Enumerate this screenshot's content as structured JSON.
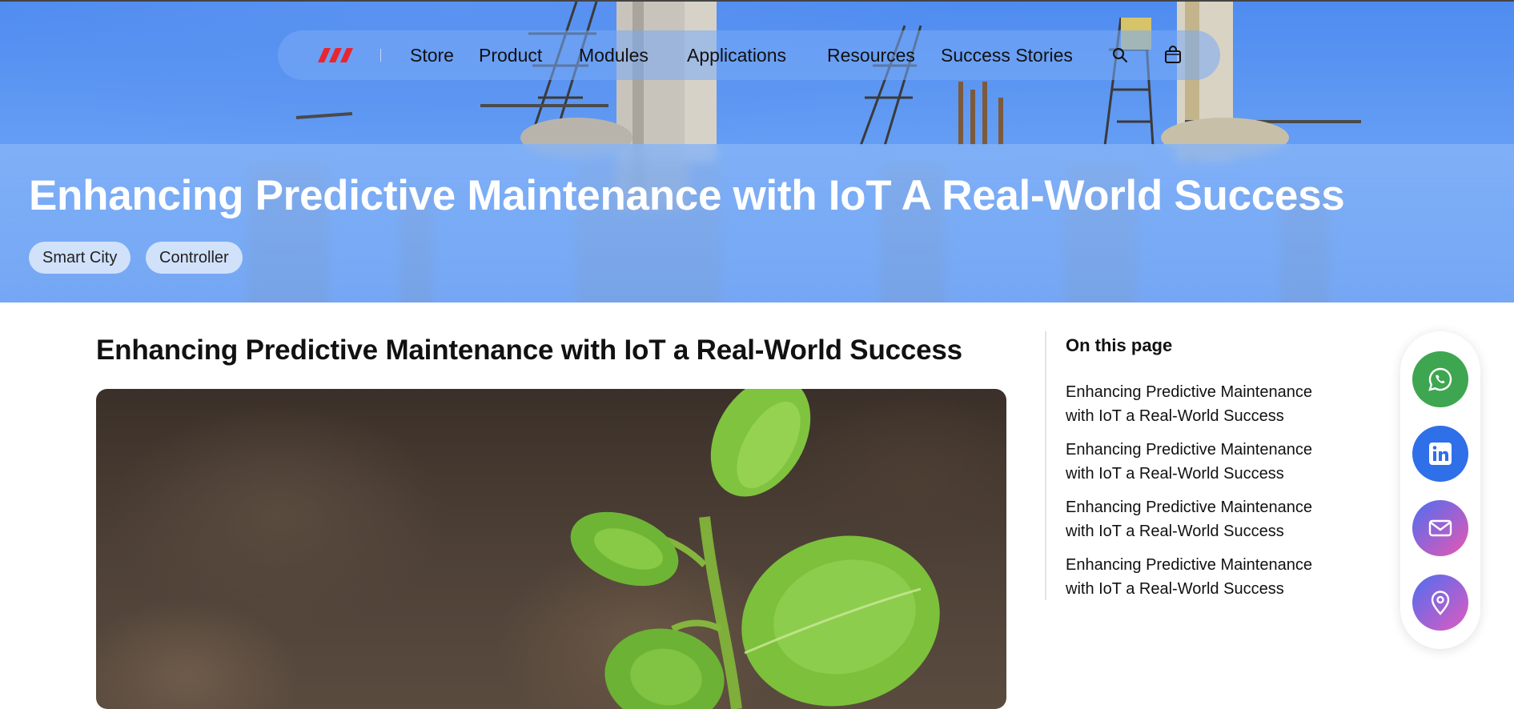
{
  "nav": {
    "items": [
      {
        "label": "Store"
      },
      {
        "label": "Product"
      },
      {
        "label": "Modules"
      },
      {
        "label": "Applications"
      },
      {
        "label": "Resources"
      },
      {
        "label": "Success Stories"
      }
    ],
    "icons": [
      "search-icon",
      "shopping-bag-icon"
    ]
  },
  "hero": {
    "title": "Enhancing Predictive Maintenance with IoT A Real-World Success",
    "tags": [
      "Smart City",
      "Controller"
    ]
  },
  "article": {
    "title": "Enhancing Predictive Maintenance with IoT a Real-World Success"
  },
  "toc": {
    "heading": "On this page",
    "items": [
      "Enhancing Predictive Maintenance with IoT a Real-World Success",
      "Enhancing Predictive Maintenance with IoT a Real-World Success",
      "Enhancing Predictive Maintenance with IoT a Real-World Success",
      "Enhancing Predictive Maintenance with IoT a Real-World Success"
    ]
  },
  "social": {
    "buttons": [
      {
        "icon": "whatsapp-icon",
        "color": "#3ea650"
      },
      {
        "icon": "linkedin-icon",
        "color": "#2f6fe8"
      },
      {
        "icon": "mail-icon",
        "color": "#6f5ce0"
      },
      {
        "icon": "location-pin-icon",
        "color": "#7b57d6"
      }
    ]
  },
  "colors": {
    "brand_red": "#e8262f",
    "hero_blue": "#5f98f2"
  }
}
